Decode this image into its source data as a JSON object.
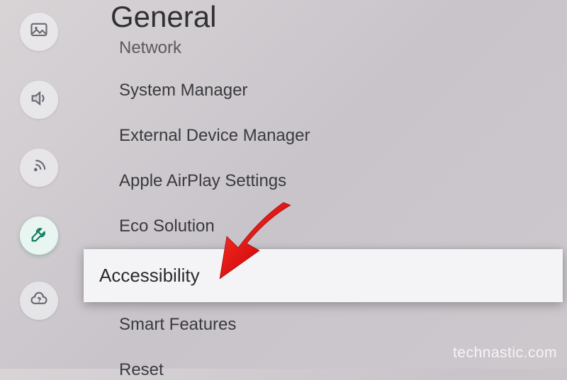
{
  "page_title": "General",
  "sidebar": {
    "items": [
      {
        "name": "picture",
        "active": false
      },
      {
        "name": "sound",
        "active": false
      },
      {
        "name": "broadcasting",
        "active": false
      },
      {
        "name": "general",
        "active": true
      },
      {
        "name": "support",
        "active": false
      }
    ]
  },
  "menu": {
    "items": [
      {
        "label": "Network",
        "partial": true
      },
      {
        "label": "System Manager"
      },
      {
        "label": "External Device Manager"
      },
      {
        "label": "Apple AirPlay Settings"
      },
      {
        "label": "Eco Solution"
      },
      {
        "label": "Accessibility",
        "highlighted": true
      },
      {
        "label": "Smart Features"
      },
      {
        "label": "Reset"
      }
    ]
  },
  "watermark": "technastic.com",
  "annotation": {
    "type": "arrow",
    "color": "#e81c1c",
    "target": "Accessibility"
  }
}
